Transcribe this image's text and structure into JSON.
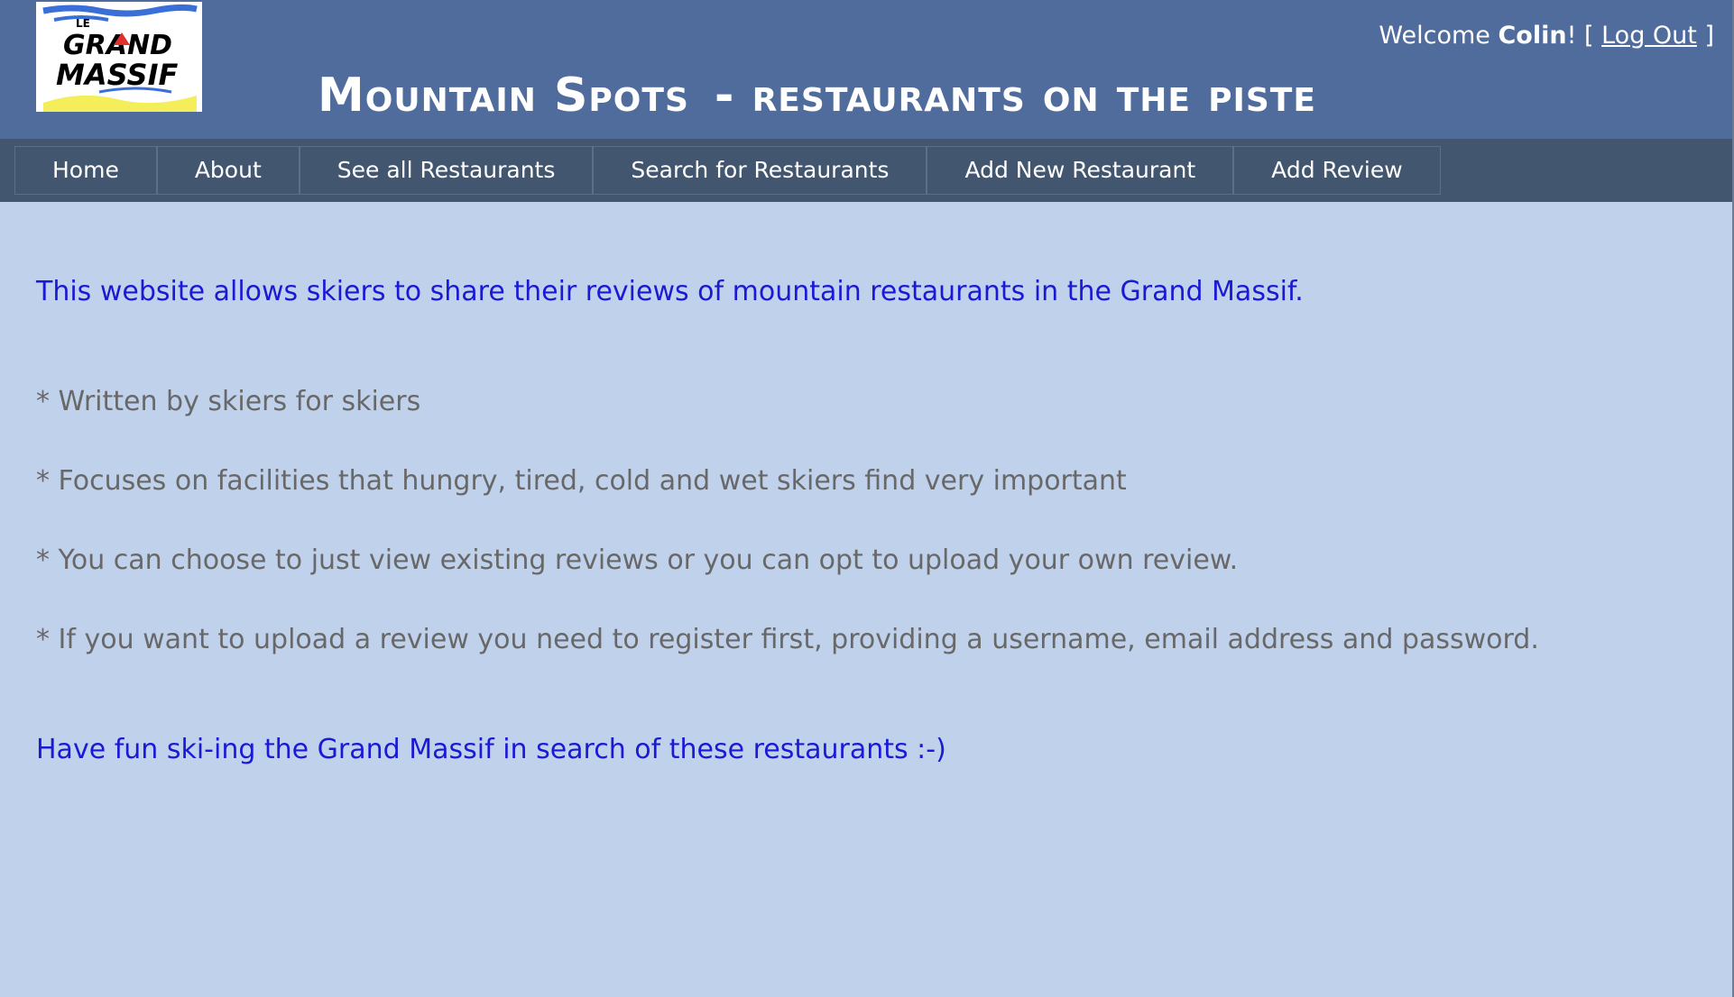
{
  "header": {
    "logo": {
      "alt": "Le Grand Massif logo",
      "line1": "LE",
      "line2": "GRAND",
      "line3": "MASSIF"
    },
    "title": "Mountain Spots",
    "subtitle": "- restaurants on the piste",
    "welcome": {
      "prefix": "Welcome ",
      "username": "Colin",
      "suffix": "! [ ",
      "logout_label": "Log Out",
      "close": " ]"
    }
  },
  "nav": {
    "items": [
      {
        "label": "Home"
      },
      {
        "label": "About"
      },
      {
        "label": "See all Restaurants"
      },
      {
        "label": "Search for Restaurants"
      },
      {
        "label": "Add New Restaurant"
      },
      {
        "label": "Add Review"
      }
    ]
  },
  "main": {
    "intro": "This website allows skiers to share their reviews of mountain restaurants in the Grand Massif.",
    "bullets": [
      "* Written by skiers for skiers",
      "* Focuses on facilities that hungry, tired, cold and wet skiers find very important",
      "* You can choose to just view existing reviews or you can opt to upload your own review.",
      "* If you want to upload a review you need to register first, providing a username, email address and password."
    ],
    "outro": "Have fun ski-ing the Grand Massif in search of these restaurants :-)"
  },
  "colors": {
    "header_bg": "#506c9c",
    "nav_bg": "#425670",
    "page_bg": "#c0d1eb",
    "link_blue": "#1a1ad6",
    "bullet_gray": "#686868"
  }
}
